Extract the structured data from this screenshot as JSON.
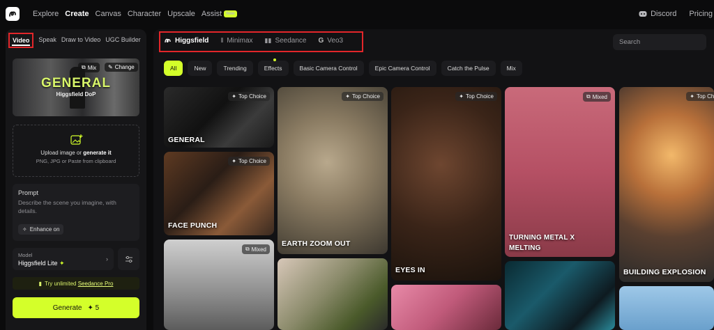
{
  "nav": {
    "items": [
      "Explore",
      "Create",
      "Canvas",
      "Character",
      "Upscale",
      "Assist"
    ],
    "active": "Create",
    "new_badge": "New",
    "discord": "Discord",
    "pricing": "Pricing"
  },
  "sidebar": {
    "tabs": [
      "Video",
      "Speak",
      "Draw to Video",
      "UGC Builder"
    ],
    "preview": {
      "title": "GENERAL",
      "subtitle": "Higgsfield DoP",
      "mix": "Mix",
      "change": "Change"
    },
    "upload": {
      "line1_prefix": "Upload image or ",
      "line1_link": "generate it",
      "line2": "PNG, JPG or Paste from clipboard"
    },
    "prompt": {
      "title": "Prompt",
      "placeholder": "Describe the scene you imagine, with details.",
      "enhance": "Enhance on"
    },
    "model": {
      "label": "Model",
      "value": "Higgsfield Lite"
    },
    "unlimited": {
      "prefix": "Try unlimited ",
      "link": "Seedance Pro"
    },
    "generate": {
      "label": "Generate",
      "cost": "5"
    }
  },
  "main": {
    "model_tabs": [
      "Higgsfield",
      "Minimax",
      "Seedance",
      "Veo3"
    ],
    "search_placeholder": "Search",
    "filters": [
      "All",
      "New",
      "Trending",
      "Effects",
      "Basic Camera Control",
      "Epic Camera Control",
      "Catch the Pulse",
      "Mix"
    ],
    "cards": {
      "general": {
        "tag": "Top Choice",
        "label": "GENERAL"
      },
      "face_punch": {
        "tag": "Top Choice",
        "label": "FACE PUNCH"
      },
      "mixed_bottom": {
        "tag": "Mixed"
      },
      "earth_zoom": {
        "tag": "Top Choice",
        "label": "EARTH ZOOM OUT"
      },
      "eyes_in": {
        "tag": "Top Choice",
        "label": "EYES IN"
      },
      "turning_metal": {
        "tag": "Mixed",
        "label": "TURNING METAL X MELTING"
      },
      "building": {
        "tag": "Top Choice",
        "label": "BUILDING EXPLOSION"
      }
    }
  },
  "colors": {
    "accent": "#d4ff2a",
    "highlight": "#e3262a"
  }
}
